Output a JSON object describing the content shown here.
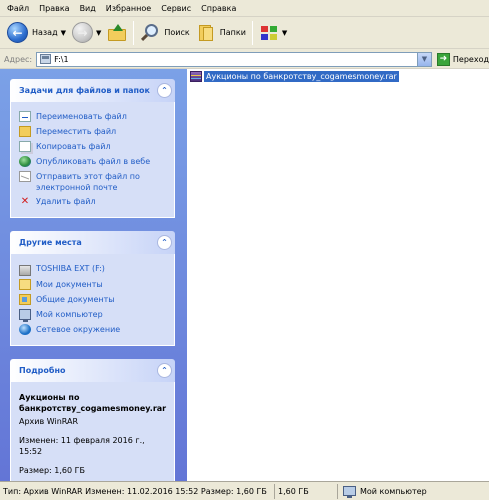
{
  "menu": [
    "Файл",
    "Правка",
    "Вид",
    "Избранное",
    "Сервис",
    "Справка"
  ],
  "toolbar": {
    "back_label": "Назад",
    "search_label": "Поиск",
    "folders_label": "Папки"
  },
  "address": {
    "label": "Адрес:",
    "value": "F:\\1",
    "go_label": "Переход"
  },
  "tasks_panel": {
    "title": "Задачи для файлов и папок",
    "items": [
      {
        "label": "Переименовать файл",
        "icon": "rename-icon"
      },
      {
        "label": "Переместить файл",
        "icon": "move-icon"
      },
      {
        "label": "Копировать файл",
        "icon": "copy-icon"
      },
      {
        "label": "Опубликовать файл в вебе",
        "icon": "publish-web-icon"
      },
      {
        "label": "Отправить этот файл по электронной почте",
        "icon": "email-icon"
      },
      {
        "label": "Удалить файл",
        "icon": "delete-icon"
      }
    ]
  },
  "places_panel": {
    "title": "Другие места",
    "items": [
      {
        "label": "TOSHIBA EXT (F:)",
        "icon": "drive-icon"
      },
      {
        "label": "Мои документы",
        "icon": "my-documents-icon"
      },
      {
        "label": "Общие документы",
        "icon": "shared-documents-icon"
      },
      {
        "label": "Мой компьютер",
        "icon": "my-computer-icon"
      },
      {
        "label": "Сетевое окружение",
        "icon": "network-icon"
      }
    ]
  },
  "details_panel": {
    "title": "Подробно",
    "name": "Аукционы по банкротству_cogamesmoney.rar",
    "type": "Архив WinRAR",
    "modified": "Изменен: 11 февраля 2016 г., 15:52",
    "size": "Размер: 1,60 ГБ"
  },
  "files": [
    {
      "name": "Аукционы по банкротству_cogamesmoney.rar",
      "icon": "winrar-archive-icon",
      "selected": true
    }
  ],
  "status": {
    "info": "Тип: Архив WinRAR Изменен: 11.02.2016 15:52 Размер: 1,60 ГБ",
    "size": "1,60 ГБ",
    "location": "Мой компьютер"
  },
  "colors": {
    "taskpane_top": "#7ba1e7",
    "taskpane_bottom": "#6375d6",
    "panel_title": "#215dc6",
    "selection": "#316ac5"
  }
}
